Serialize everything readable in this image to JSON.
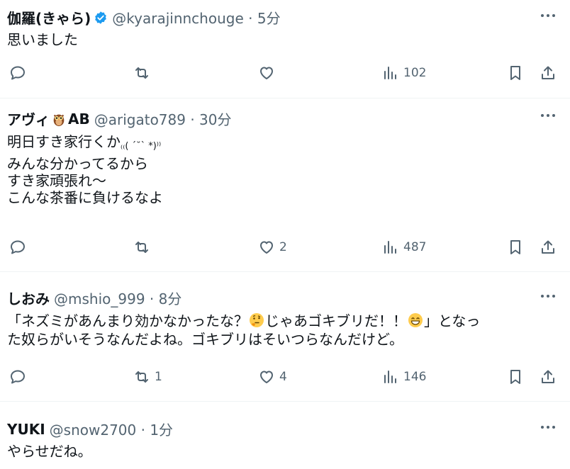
{
  "tweets": [
    {
      "name": "伽羅(きゃら)",
      "meta": "@kyarajinnchouge · 5分",
      "text": "思いました",
      "replies": "",
      "retweets": "",
      "likes": "",
      "views": "102"
    },
    {
      "name_prefix": "アヴィ",
      "name_suffix": "AB",
      "meta": "@arigato789 · 30分",
      "text_line1_a": "明日すき家行くか",
      "text_line1_b": "₍₍( ´˘` *)⁾⁾",
      "text_rest": "みんな分かってるから\nすき家頑張れ〜\nこんな茶番に負けるなよ",
      "replies": "",
      "retweets": "",
      "likes": "2",
      "views": "487"
    },
    {
      "name": "しおみ",
      "meta": "@mshio_999 · 8分",
      "text_a": "「ネズミがあんまり効かなかったな？",
      "text_b": "じゃあゴキブリだ！！",
      "text_c": "」となっ",
      "text_line2": "た奴らがいそうなんだよね。ゴキブリはそいつらなんだけど。",
      "replies": "",
      "retweets": "1",
      "likes": "4",
      "views": "146"
    },
    {
      "name": "YUKI",
      "meta": "@snow2700 · 1分",
      "text": "やらせだね。"
    }
  ],
  "icons": {
    "reply": "reply-icon",
    "retweet": "retweet-icon",
    "like": "heart-icon",
    "views": "views-icon",
    "bookmark": "bookmark-icon",
    "share": "share-icon",
    "more": "more-icon",
    "verified": "verified-badge-icon"
  },
  "colors": {
    "verified": "#1d9bf0",
    "muted": "#536471",
    "text": "#0f1419"
  }
}
